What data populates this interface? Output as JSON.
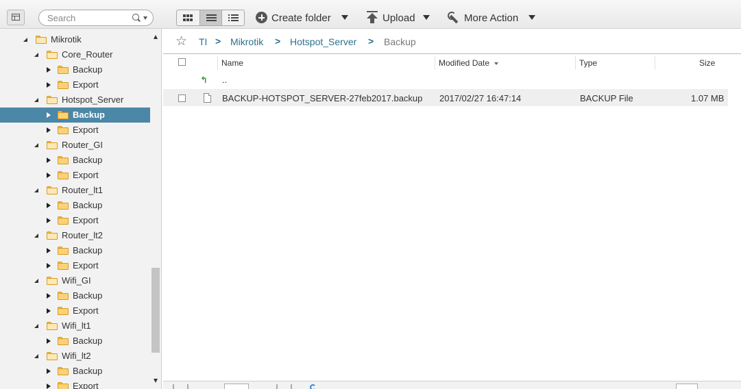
{
  "toolbar": {
    "search_placeholder": "Search",
    "create_folder_label": "Create folder",
    "upload_label": "Upload",
    "more_action_label": "More Action"
  },
  "sidebar": {
    "root": "Mikrotik",
    "groups": [
      {
        "name": "Core_Router",
        "children": [
          "Backup",
          "Export"
        ]
      },
      {
        "name": "Hotspot_Server",
        "children": [
          "Backup",
          "Export"
        ],
        "selected_child": "Backup"
      },
      {
        "name": "Router_GI",
        "children": [
          "Backup",
          "Export"
        ]
      },
      {
        "name": "Router_lt1",
        "children": [
          "Backup",
          "Export"
        ]
      },
      {
        "name": "Router_lt2",
        "children": [
          "Backup",
          "Export"
        ]
      },
      {
        "name": "Wifi_GI",
        "children": [
          "Backup",
          "Export"
        ]
      },
      {
        "name": "Wifi_lt1",
        "children": [
          "Backup"
        ]
      },
      {
        "name": "Wifi_lt2",
        "children": [
          "Backup",
          "Export"
        ]
      }
    ]
  },
  "breadcrumb": {
    "items": [
      "TI",
      "Mikrotik",
      "Hotspot_Server",
      "Backup"
    ],
    "separator": ">"
  },
  "table": {
    "columns": [
      "Name",
      "Modified Date",
      "Type",
      "Size"
    ],
    "sorted_column": "Modified Date",
    "parent_label": "..",
    "rows": [
      {
        "name": "BACKUP-HOTSPOT_SERVER-27feb2017.backup",
        "modified": "2017/02/27 16:47:14",
        "type": "BACKUP File",
        "size": "1.07 MB"
      }
    ]
  },
  "colors": {
    "selection": "#4b87a6",
    "link": "#2e6f8e",
    "folder": "#fbd27a"
  }
}
